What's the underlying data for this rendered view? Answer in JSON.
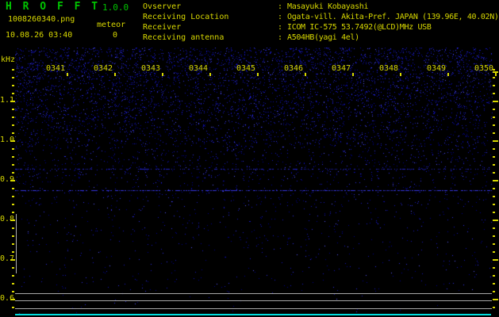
{
  "header": {
    "app_title": "H R O F F T",
    "version": "1.0.0",
    "filename": "1008260340.png",
    "mode": "meteor",
    "echo_count": "0",
    "datetime": "10.08.26 03:40",
    "info": [
      {
        "label": "Ovserver",
        "sep": ": ",
        "value": "Masayuki Kobayashi"
      },
      {
        "label": "Receiving Location",
        "sep": ": ",
        "value": "Ogata-vill. Akita-Pref. JAPAN (139.96E, 40.02N)"
      },
      {
        "label": "Receiver",
        "sep": ": ",
        "value": "ICOM IC-575 53.7492(@LCD)MHz USB"
      },
      {
        "label": "Receiving antenna",
        "sep": ": ",
        "value": "A504HB(yagi 4el)"
      }
    ]
  },
  "spectrogram": {
    "unit_label": "kHz",
    "freq_ticks": [
      "1.1",
      "1.0",
      "0.9",
      "0.8",
      "0.7",
      "0.6"
    ],
    "time_ticks": [
      "0341",
      "0342",
      "0343",
      "0344",
      "0345",
      "0346",
      "0347",
      "0348",
      "0349",
      "0350"
    ],
    "colors": {
      "title_green": "#00c400",
      "text_yellow": "#d8d800",
      "noise_blue_dim": "#000090",
      "noise_blue_mid": "#1818c0",
      "noise_blue_bright": "#3030e8",
      "noise_blue_peak": "#5858ff",
      "level_trace_gray": "#a8a8a8",
      "baseline_cyan": "#00dede",
      "background": "#000000"
    }
  }
}
